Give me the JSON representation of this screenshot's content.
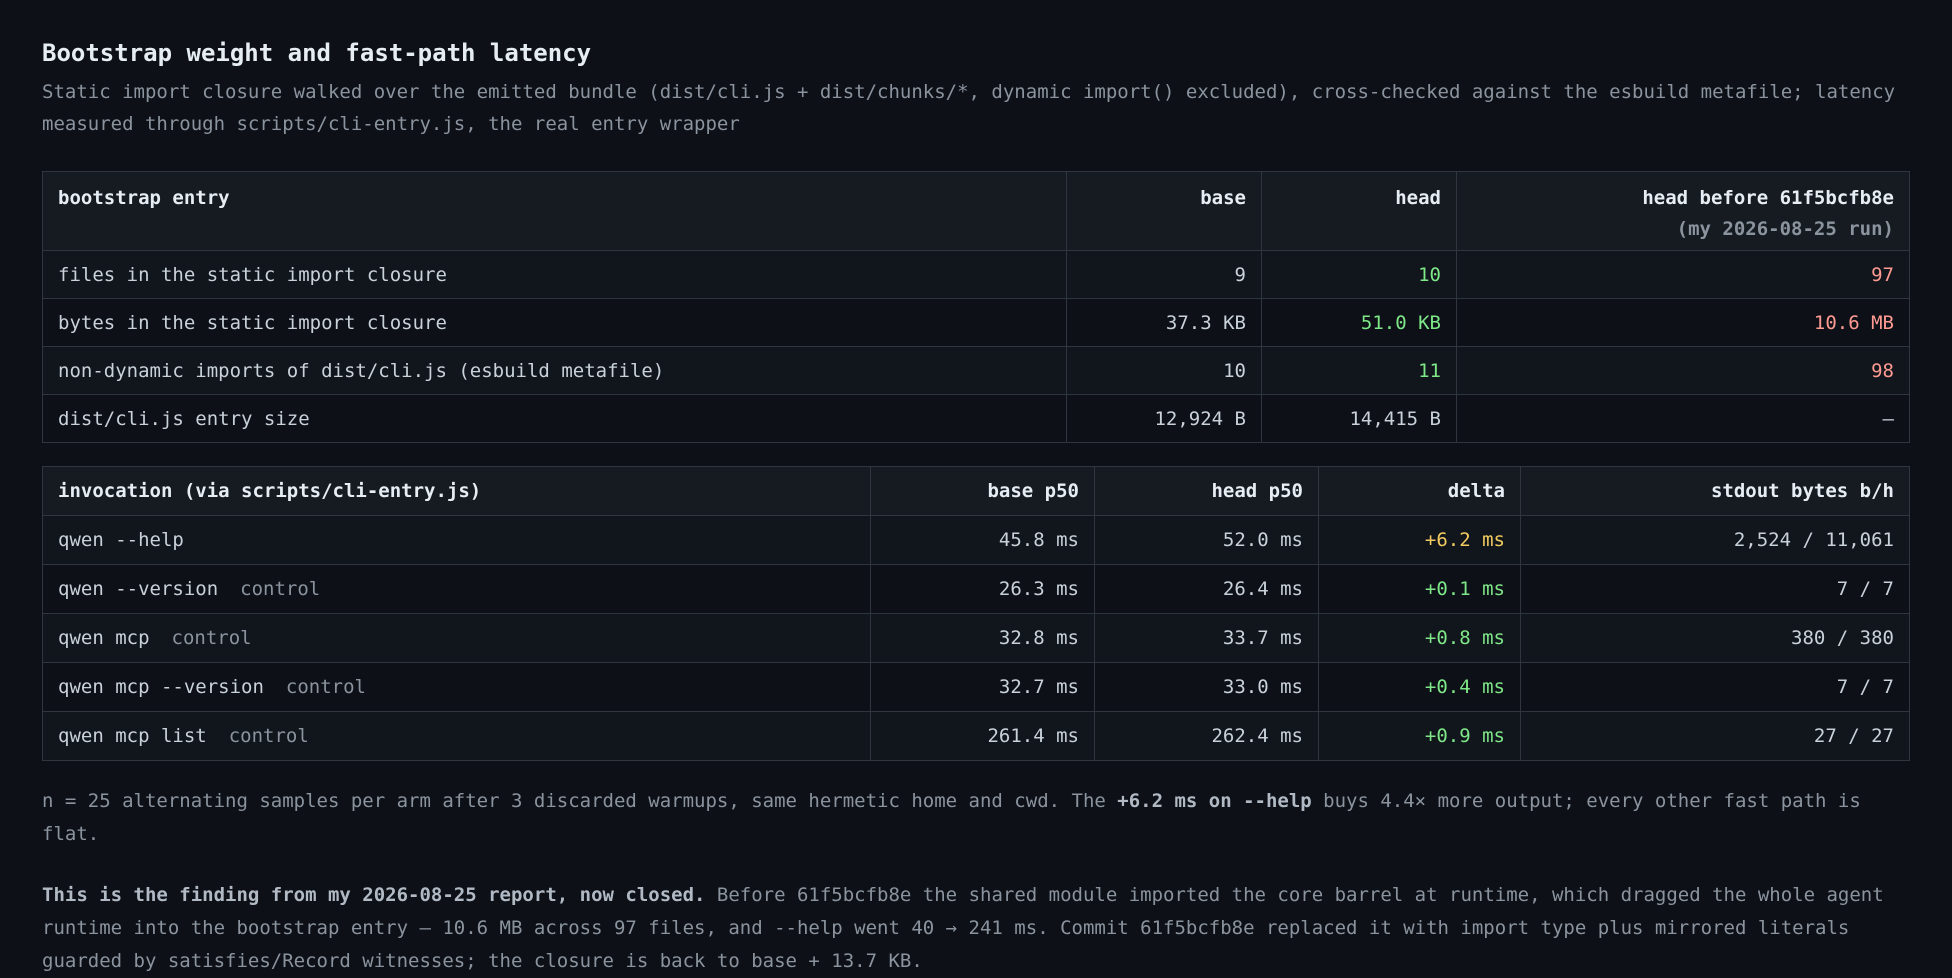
{
  "title": "Bootstrap weight and fast-path latency",
  "subtitle": "Static import closure walked over the emitted bundle (dist/cli.js + dist/chunks/*, dynamic import() excluded), cross-checked against the esbuild metafile; latency measured through scripts/cli-entry.js, the real entry wrapper",
  "bootstrap": {
    "headers": {
      "entry": "bootstrap entry",
      "base": "base",
      "head": "head",
      "before": "head before 61f5bcfb8e",
      "before_sub": "(my 2026-08-25 run)"
    },
    "rows": [
      {
        "label": "files in the static import closure",
        "base": "9",
        "head": "10",
        "before": "97"
      },
      {
        "label": "bytes in the static import closure",
        "base": "37.3 KB",
        "head": "51.0 KB",
        "before": "10.6 MB"
      },
      {
        "label": "non-dynamic imports of dist/cli.js (esbuild metafile)",
        "base": "10",
        "head": "11",
        "before": "98"
      },
      {
        "label": "dist/cli.js entry size",
        "base": "12,924 B",
        "head": "14,415 B",
        "before": "–"
      }
    ]
  },
  "invocation": {
    "headers": {
      "cmd": "invocation (via scripts/cli-entry.js)",
      "base": "base p50",
      "head": "head p50",
      "delta": "delta",
      "stdout": "stdout bytes b/h"
    },
    "rows": [
      {
        "cmd": "qwen --help",
        "tag": "",
        "base": "45.8 ms",
        "head": "52.0 ms",
        "delta": "+6.2 ms",
        "stdout": "2,524 / 11,061"
      },
      {
        "cmd": "qwen --version",
        "tag": "control",
        "base": "26.3 ms",
        "head": "26.4 ms",
        "delta": "+0.1 ms",
        "stdout": "7 / 7"
      },
      {
        "cmd": "qwen mcp",
        "tag": "control",
        "base": "32.8 ms",
        "head": "33.7 ms",
        "delta": "+0.8 ms",
        "stdout": "380 / 380"
      },
      {
        "cmd": "qwen mcp --version",
        "tag": "control",
        "base": "32.7 ms",
        "head": "33.0 ms",
        "delta": "+0.4 ms",
        "stdout": "7 / 7"
      },
      {
        "cmd": "qwen mcp list",
        "tag": "control",
        "base": "261.4 ms",
        "head": "262.4 ms",
        "delta": "+0.9 ms",
        "stdout": "27 / 27"
      }
    ]
  },
  "note1": {
    "pre": "n = 25 alternating samples per arm after 3 discarded warmups, same hermetic home and cwd. The ",
    "bold": "+6.2 ms on --help",
    "post": " buys 4.4× more output; every other fast path is flat."
  },
  "note2": {
    "bold": "This is the finding from my 2026-08-25 report, now closed.",
    "rest": " Before 61f5bcfb8e the shared module imported the core barrel at runtime, which dragged the whole agent runtime into the bootstrap entry — 10.6 MB across 97 files, and --help went 40 → 241 ms. Commit 61f5bcfb8e replaced it with import type plus mirrored literals guarded by satisfies/Record witnesses; the closure is back to base + 13.7 KB."
  },
  "colors": {
    "background": "#0d1017",
    "improved": "#7ee787",
    "regressed": "#ff9b92",
    "warning": "#f2cc60",
    "muted": "#8b949e"
  }
}
